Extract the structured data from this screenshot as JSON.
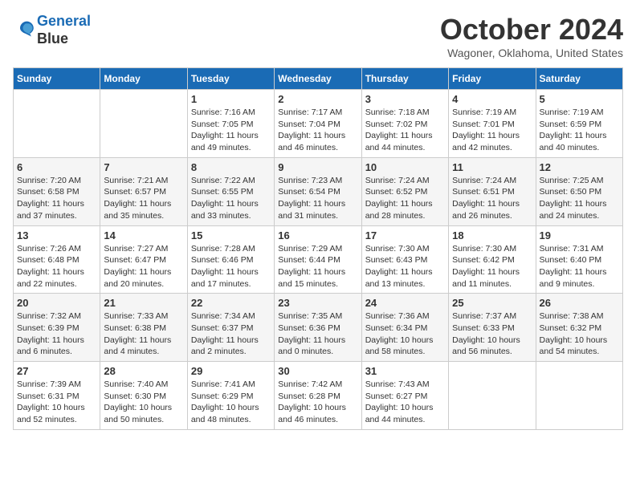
{
  "logo": {
    "line1": "General",
    "line2": "Blue"
  },
  "title": "October 2024",
  "location": "Wagoner, Oklahoma, United States",
  "days_of_week": [
    "Sunday",
    "Monday",
    "Tuesday",
    "Wednesday",
    "Thursday",
    "Friday",
    "Saturday"
  ],
  "weeks": [
    [
      {
        "day": "",
        "info": ""
      },
      {
        "day": "",
        "info": ""
      },
      {
        "day": "1",
        "info": "Sunrise: 7:16 AM\nSunset: 7:05 PM\nDaylight: 11 hours and 49 minutes."
      },
      {
        "day": "2",
        "info": "Sunrise: 7:17 AM\nSunset: 7:04 PM\nDaylight: 11 hours and 46 minutes."
      },
      {
        "day": "3",
        "info": "Sunrise: 7:18 AM\nSunset: 7:02 PM\nDaylight: 11 hours and 44 minutes."
      },
      {
        "day": "4",
        "info": "Sunrise: 7:19 AM\nSunset: 7:01 PM\nDaylight: 11 hours and 42 minutes."
      },
      {
        "day": "5",
        "info": "Sunrise: 7:19 AM\nSunset: 6:59 PM\nDaylight: 11 hours and 40 minutes."
      }
    ],
    [
      {
        "day": "6",
        "info": "Sunrise: 7:20 AM\nSunset: 6:58 PM\nDaylight: 11 hours and 37 minutes."
      },
      {
        "day": "7",
        "info": "Sunrise: 7:21 AM\nSunset: 6:57 PM\nDaylight: 11 hours and 35 minutes."
      },
      {
        "day": "8",
        "info": "Sunrise: 7:22 AM\nSunset: 6:55 PM\nDaylight: 11 hours and 33 minutes."
      },
      {
        "day": "9",
        "info": "Sunrise: 7:23 AM\nSunset: 6:54 PM\nDaylight: 11 hours and 31 minutes."
      },
      {
        "day": "10",
        "info": "Sunrise: 7:24 AM\nSunset: 6:52 PM\nDaylight: 11 hours and 28 minutes."
      },
      {
        "day": "11",
        "info": "Sunrise: 7:24 AM\nSunset: 6:51 PM\nDaylight: 11 hours and 26 minutes."
      },
      {
        "day": "12",
        "info": "Sunrise: 7:25 AM\nSunset: 6:50 PM\nDaylight: 11 hours and 24 minutes."
      }
    ],
    [
      {
        "day": "13",
        "info": "Sunrise: 7:26 AM\nSunset: 6:48 PM\nDaylight: 11 hours and 22 minutes."
      },
      {
        "day": "14",
        "info": "Sunrise: 7:27 AM\nSunset: 6:47 PM\nDaylight: 11 hours and 20 minutes."
      },
      {
        "day": "15",
        "info": "Sunrise: 7:28 AM\nSunset: 6:46 PM\nDaylight: 11 hours and 17 minutes."
      },
      {
        "day": "16",
        "info": "Sunrise: 7:29 AM\nSunset: 6:44 PM\nDaylight: 11 hours and 15 minutes."
      },
      {
        "day": "17",
        "info": "Sunrise: 7:30 AM\nSunset: 6:43 PM\nDaylight: 11 hours and 13 minutes."
      },
      {
        "day": "18",
        "info": "Sunrise: 7:30 AM\nSunset: 6:42 PM\nDaylight: 11 hours and 11 minutes."
      },
      {
        "day": "19",
        "info": "Sunrise: 7:31 AM\nSunset: 6:40 PM\nDaylight: 11 hours and 9 minutes."
      }
    ],
    [
      {
        "day": "20",
        "info": "Sunrise: 7:32 AM\nSunset: 6:39 PM\nDaylight: 11 hours and 6 minutes."
      },
      {
        "day": "21",
        "info": "Sunrise: 7:33 AM\nSunset: 6:38 PM\nDaylight: 11 hours and 4 minutes."
      },
      {
        "day": "22",
        "info": "Sunrise: 7:34 AM\nSunset: 6:37 PM\nDaylight: 11 hours and 2 minutes."
      },
      {
        "day": "23",
        "info": "Sunrise: 7:35 AM\nSunset: 6:36 PM\nDaylight: 11 hours and 0 minutes."
      },
      {
        "day": "24",
        "info": "Sunrise: 7:36 AM\nSunset: 6:34 PM\nDaylight: 10 hours and 58 minutes."
      },
      {
        "day": "25",
        "info": "Sunrise: 7:37 AM\nSunset: 6:33 PM\nDaylight: 10 hours and 56 minutes."
      },
      {
        "day": "26",
        "info": "Sunrise: 7:38 AM\nSunset: 6:32 PM\nDaylight: 10 hours and 54 minutes."
      }
    ],
    [
      {
        "day": "27",
        "info": "Sunrise: 7:39 AM\nSunset: 6:31 PM\nDaylight: 10 hours and 52 minutes."
      },
      {
        "day": "28",
        "info": "Sunrise: 7:40 AM\nSunset: 6:30 PM\nDaylight: 10 hours and 50 minutes."
      },
      {
        "day": "29",
        "info": "Sunrise: 7:41 AM\nSunset: 6:29 PM\nDaylight: 10 hours and 48 minutes."
      },
      {
        "day": "30",
        "info": "Sunrise: 7:42 AM\nSunset: 6:28 PM\nDaylight: 10 hours and 46 minutes."
      },
      {
        "day": "31",
        "info": "Sunrise: 7:43 AM\nSunset: 6:27 PM\nDaylight: 10 hours and 44 minutes."
      },
      {
        "day": "",
        "info": ""
      },
      {
        "day": "",
        "info": ""
      }
    ]
  ]
}
